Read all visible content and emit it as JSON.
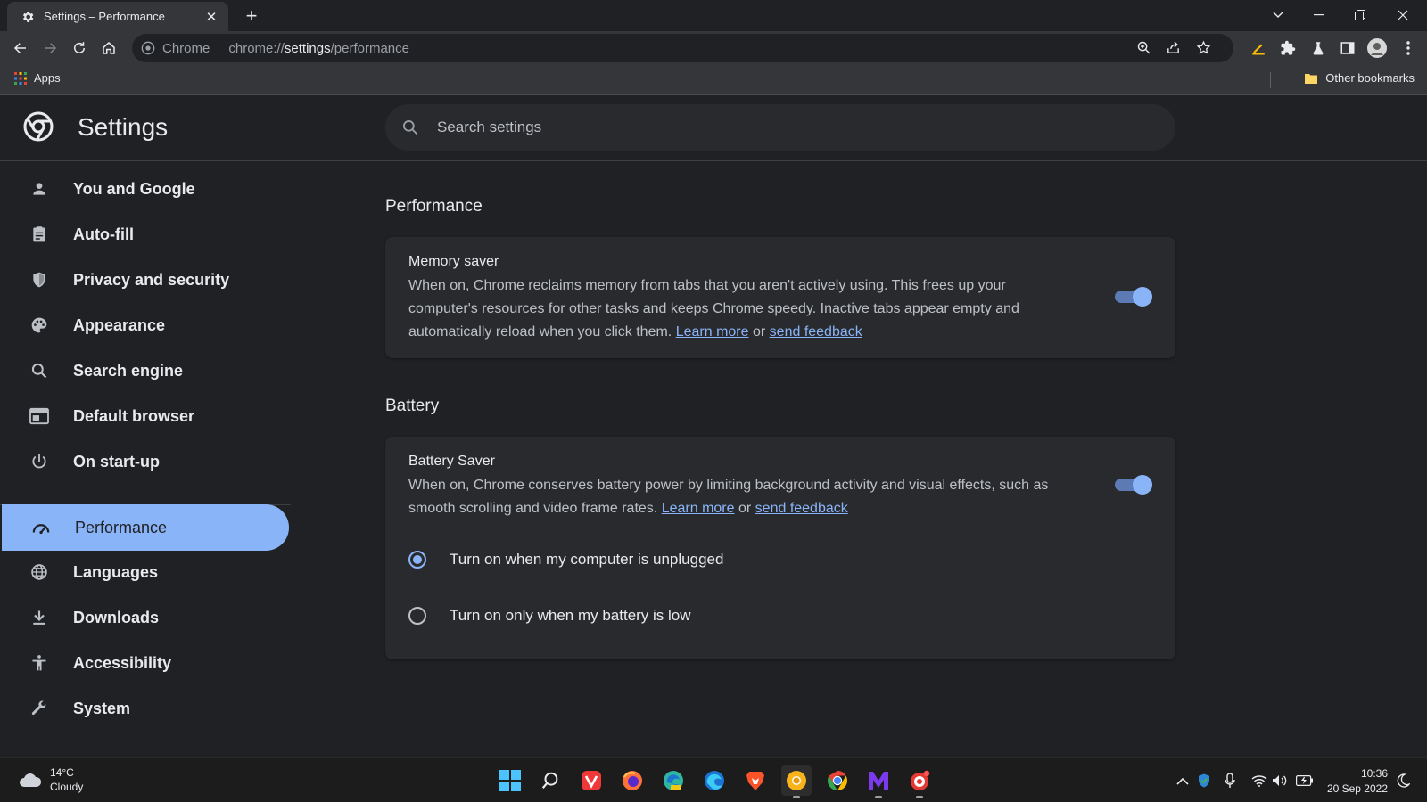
{
  "browser": {
    "tab_title": "Settings – Performance",
    "url_chip": "Chrome",
    "url_prefix": "chrome://",
    "url_host": "settings",
    "url_path": "/performance",
    "bookmarks": {
      "apps": "Apps",
      "other": "Other bookmarks"
    }
  },
  "header": {
    "title": "Settings",
    "search_placeholder": "Search settings"
  },
  "sidebar": {
    "items": [
      {
        "label": "You and Google",
        "icon": "person-icon"
      },
      {
        "label": "Auto-fill",
        "icon": "clipboard-icon"
      },
      {
        "label": "Privacy and security",
        "icon": "shield-icon"
      },
      {
        "label": "Appearance",
        "icon": "palette-icon"
      },
      {
        "label": "Search engine",
        "icon": "search-icon"
      },
      {
        "label": "Default browser",
        "icon": "browser-icon"
      },
      {
        "label": "On start-up",
        "icon": "power-icon"
      },
      {
        "label": "Performance",
        "icon": "speedometer-icon",
        "active": true
      },
      {
        "label": "Languages",
        "icon": "globe-icon"
      },
      {
        "label": "Downloads",
        "icon": "download-icon"
      },
      {
        "label": "Accessibility",
        "icon": "accessibility-icon"
      },
      {
        "label": "System",
        "icon": "wrench-icon"
      }
    ]
  },
  "main": {
    "performance_title": "Performance",
    "memory_saver": {
      "title": "Memory saver",
      "desc_1": "When on, Chrome reclaims memory from tabs that you aren't actively using. This frees up your",
      "desc_2": "computer's resources for other tasks and keeps Chrome speedy. Inactive tabs appear empty and",
      "desc_3": "automatically reload when you click them.",
      "learn_more": "Learn more",
      "or": "or",
      "send_feedback": "send feedback",
      "enabled": true
    },
    "battery_title": "Battery",
    "battery_saver": {
      "title": "Battery Saver",
      "desc_1": "When on, Chrome conserves battery power by limiting background activity and visual effects, such as",
      "desc_2": "smooth scrolling and video frame rates.",
      "learn_more": "Learn more",
      "or": "or",
      "send_feedback": "send feedback",
      "enabled": true,
      "options": [
        {
          "label": "Turn on when my computer is unplugged",
          "checked": true
        },
        {
          "label": "Turn on only when my battery is low",
          "checked": false
        }
      ]
    }
  },
  "taskbar": {
    "weather_temp": "14°C",
    "weather_desc": "Cloudy",
    "time": "10:36",
    "date": "20 Sep 2022"
  },
  "colors": {
    "accent": "#8ab4f8",
    "background": "#202124",
    "card": "#292a2d"
  }
}
